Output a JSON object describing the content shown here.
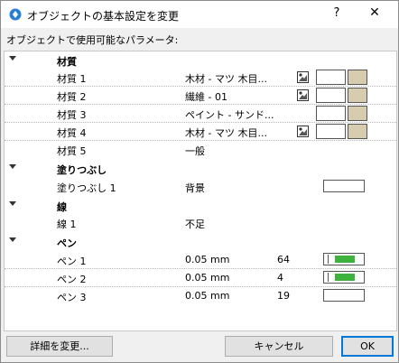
{
  "window": {
    "title": "オブジェクトの基本設定を変更",
    "help_label": "?",
    "close_label": "✕"
  },
  "params_label": "オブジェクトで使用可能なパラメータ:",
  "groups": {
    "material": {
      "label": "材質",
      "items": [
        {
          "name": "材質 1",
          "value": "木材 - マツ 木目...",
          "has_picker": true,
          "swatch": "#d8ccb0"
        },
        {
          "name": "材質 2",
          "value": "繊維 - 01",
          "has_picker": true,
          "swatch": "#d8ccb0"
        },
        {
          "name": "材質 3",
          "value": "ペイント - サンド...",
          "has_picker": false,
          "swatch": "#d8ccb0"
        },
        {
          "name": "材質 4",
          "value": "木材 - マツ 木目...",
          "has_picker": true,
          "swatch": "#d8ccb0"
        },
        {
          "name": "材質 5",
          "value": "一般"
        }
      ]
    },
    "fill": {
      "label": "塗りつぶし",
      "items": [
        {
          "name": "塗りつぶし 1",
          "value": "背景"
        }
      ]
    },
    "line": {
      "label": "線",
      "items": [
        {
          "name": "線 1",
          "value": "不足"
        }
      ]
    },
    "pen": {
      "label": "ペン",
      "items": [
        {
          "name": "ペン 1",
          "value": "0.05 mm",
          "number": "64",
          "bar_fraction": 0.72
        },
        {
          "name": "ペン 2",
          "value": "0.05 mm",
          "number": "4",
          "bar_fraction": 0.72
        },
        {
          "name": "ペン 3",
          "value": "0.05 mm",
          "number": "19",
          "bar_fraction": 0
        }
      ]
    }
  },
  "buttons": {
    "details": "詳細を変更...",
    "cancel": "キャンセル",
    "ok": "OK"
  },
  "colors": {
    "pen_bar": "#3db33d",
    "material_swatch": "#d8ccb0",
    "accent": "#0078d7"
  }
}
